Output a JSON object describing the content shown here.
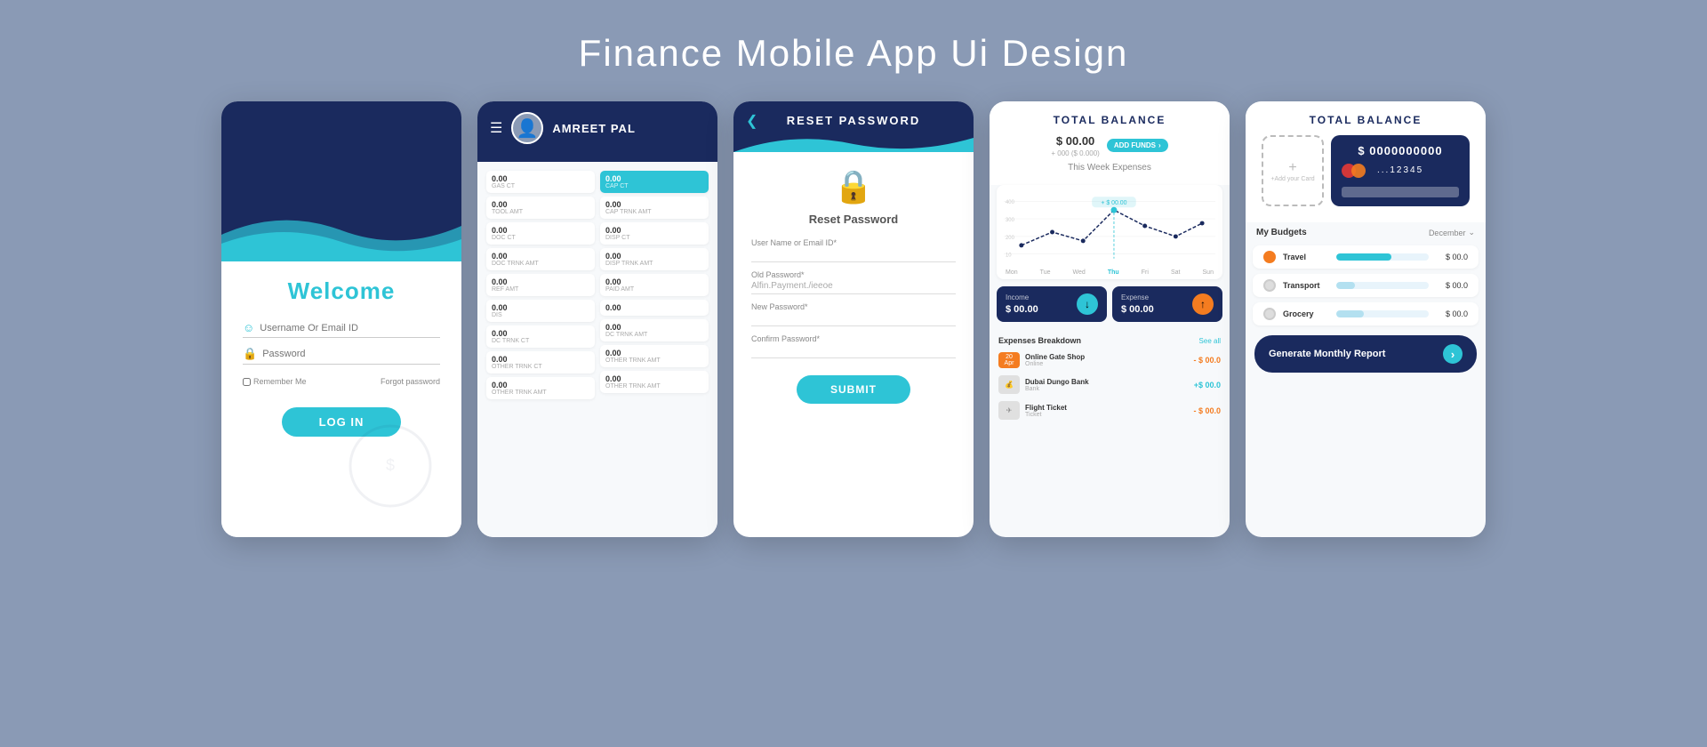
{
  "page": {
    "title": "Finance Mobile App Ui Design",
    "bg_color": "#8a9ab5"
  },
  "screen1": {
    "welcome": "Welcome",
    "username_placeholder": "Username Or Email ID",
    "password_placeholder": "Password",
    "remember_label": "Remember Me",
    "forgot_label": "Forgot password",
    "login_btn": "LOG IN"
  },
  "screen2": {
    "user_name": "AMREET PAL",
    "col1": [
      {
        "val": "0.00",
        "top": "GAS CT"
      },
      {
        "val": "0.00",
        "top": "TOOL AMT"
      },
      {
        "val": "0.00",
        "top": "DOC CT"
      },
      {
        "val": "0.00",
        "top": "DOC TRNK AMT"
      },
      {
        "val": "0.00",
        "top": "REF AMT"
      },
      {
        "val": "0.00",
        "top": "DIS"
      },
      {
        "val": "0.00",
        "top": "DC TRNK CT"
      },
      {
        "val": "0.00",
        "top": "OTHER TRNK CT"
      },
      {
        "val": "0.00",
        "top": "OTHER TRNK AMT"
      }
    ],
    "col2": [
      {
        "val": "0.00",
        "top": "CAP CT"
      },
      {
        "val": "0.00",
        "top": "CAP TRNK AMT"
      },
      {
        "val": "0.00",
        "top": "DISP CT"
      },
      {
        "val": "0.00",
        "top": "DISP TRNK AMT"
      },
      {
        "val": "0.00",
        "top": "PAID AMT"
      },
      {
        "val": "0.00",
        "top": ""
      },
      {
        "val": "0.00",
        "top": "DC TRNK AMT"
      },
      {
        "val": "0.00",
        "top": "OTHER TRNK AMT"
      },
      {
        "val": "0.00",
        "top": "OTHER TRNK AMT"
      }
    ]
  },
  "screen3": {
    "header_title": "RESET PASSWORD",
    "subtitle": "Reset Password",
    "username_label": "User Name or Email ID*",
    "old_password_label": "Old Password*",
    "old_password_value": "Alfin.Payment./ieeoe",
    "new_password_label": "New Password*",
    "confirm_password_label": "Confirm Password*",
    "submit_btn": "SUBMIT"
  },
  "screen4": {
    "header_title": "TOTAL BALANCE",
    "balance_amount": "$ 00.00",
    "balance_sub": "+ 000 ($ 0.000)",
    "add_funds": "ADD FUNDS",
    "this_week": "This Week Expenses",
    "chart_days": [
      "Mon",
      "Tue",
      "Wed",
      "Thu",
      "Fri",
      "Sat",
      "Sun"
    ],
    "chart_active_day": "Thu",
    "chart_label": "+ $ 00.00",
    "income_label": "Income",
    "income_amount": "$ 00.00",
    "expense_label": "Expense",
    "expense_amount": "$ 00.00",
    "breakdown_title": "Expenses Breakdown",
    "see_all": "See all",
    "transactions": [
      {
        "date": "20\nApr",
        "type": "orange",
        "name": "Online Gate Shop",
        "sub": "Online",
        "amount": "- $ 00.0",
        "positive": false
      },
      {
        "date": "--",
        "type": "gray",
        "name": "Dubai Dungo Bank",
        "sub": "Bank",
        "amount": "+ $ 00.0",
        "positive": true
      },
      {
        "date": "--",
        "type": "gray",
        "name": "Flight Ticket",
        "sub": "Ticket",
        "amount": "- $ 00.0",
        "positive": false
      }
    ]
  },
  "screen5": {
    "header_title": "TOTAL BALANCE",
    "card_number": "$ 0000000000",
    "card_dots": "...12345",
    "add_card_label": "+Add your Card",
    "budgets_title": "My Budgets",
    "budgets_month": "December",
    "budgets": [
      {
        "name": "Travel",
        "amount": "$ 00.0",
        "fill": 60,
        "dot": "orange"
      },
      {
        "name": "Transport",
        "amount": "$ 00.0",
        "fill": 20,
        "dot": "gray"
      },
      {
        "name": "Grocery",
        "amount": "$ 00.0",
        "fill": 30,
        "dot": "gray"
      }
    ],
    "generate_btn": "Generate Monthly Report"
  }
}
